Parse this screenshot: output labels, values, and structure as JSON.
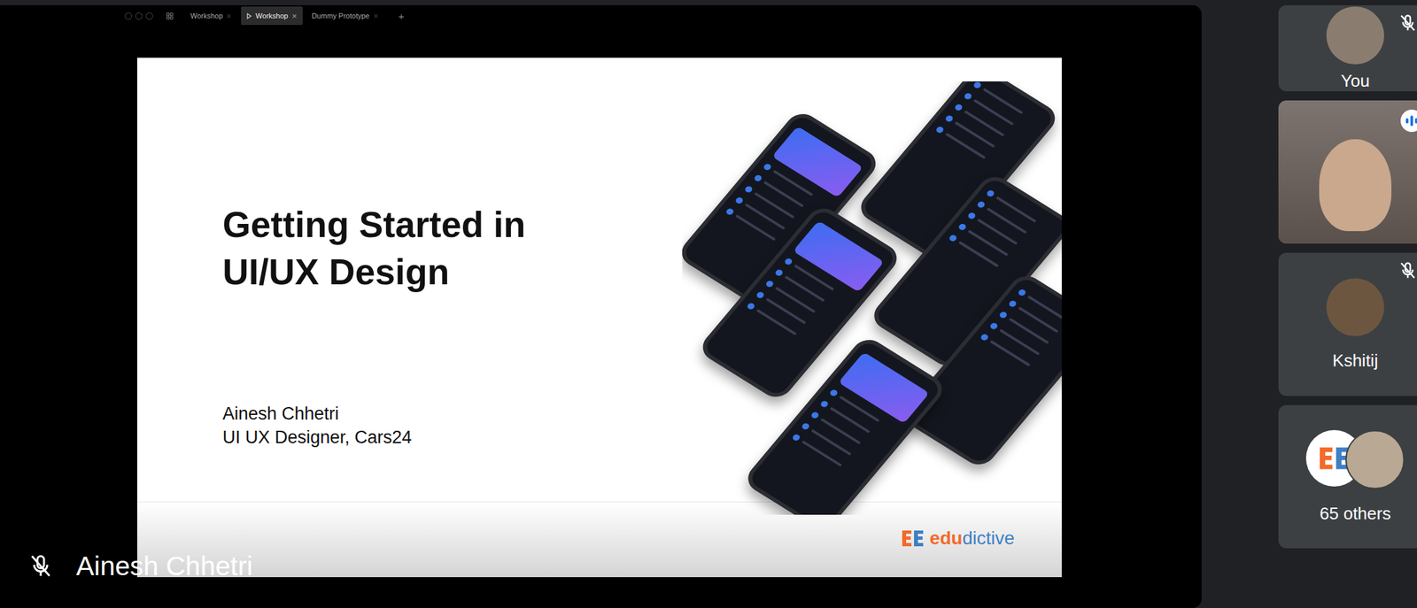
{
  "app_tabs": [
    {
      "label": "Workshop",
      "selected": false
    },
    {
      "label": "Workshop",
      "selected": true
    },
    {
      "label": "Dummy Prototype",
      "selected": false
    }
  ],
  "new_tab": "+",
  "slide": {
    "title_lines": [
      "Getting Started in",
      "UI/UX Design"
    ],
    "presenter": "Ainesh Chhetri",
    "role": "UI UX Designer, Cars24",
    "logo": [
      {
        "text": "edu",
        "color": "#f26b2a"
      },
      {
        "text": "dictive",
        "color": "#3f7fc6"
      }
    ]
  },
  "presenter": {
    "name": "Ainesh Chhetri",
    "muted": true
  },
  "participants": [
    {
      "kind": "avatar",
      "label": "You",
      "muted": true,
      "speaking": false
    },
    {
      "kind": "video",
      "label": "",
      "muted": false,
      "speaking": true
    },
    {
      "kind": "avatar",
      "label": "Kshitij",
      "muted": true,
      "speaking": false
    },
    {
      "kind": "group",
      "label": "65 others",
      "muted": false,
      "speaking": false
    }
  ]
}
